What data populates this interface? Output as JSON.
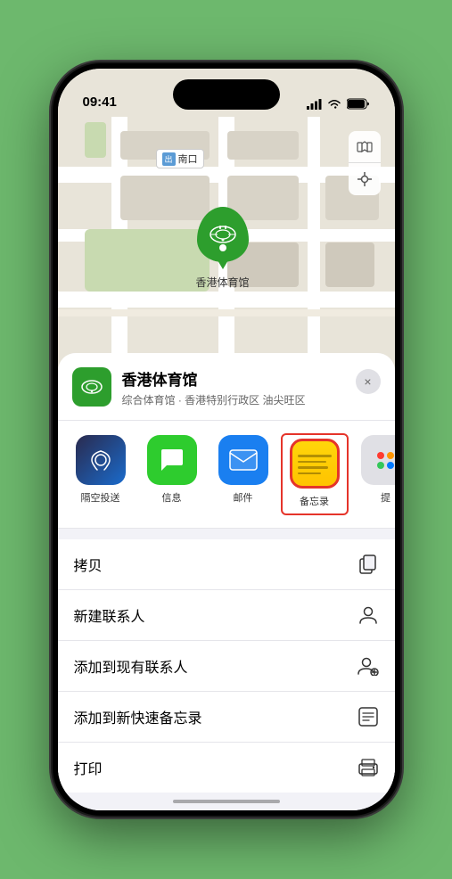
{
  "statusBar": {
    "time": "09:41",
    "locationArrow": "▶"
  },
  "map": {
    "locationLabel": "南口",
    "locationBadge": "出"
  },
  "venue": {
    "name": "香港体育馆",
    "description": "综合体育馆 · 香港特别行政区 油尖旺区",
    "pinLabel": "香港体育馆"
  },
  "shareRow": {
    "items": [
      {
        "id": "airdrop",
        "label": "隔空投送",
        "type": "airdrop"
      },
      {
        "id": "message",
        "label": "信息",
        "type": "message"
      },
      {
        "id": "mail",
        "label": "邮件",
        "type": "mail"
      },
      {
        "id": "notes",
        "label": "备忘录",
        "type": "notes"
      }
    ],
    "moreLabel": "提"
  },
  "actions": [
    {
      "id": "copy",
      "label": "拷贝",
      "icon": "copy"
    },
    {
      "id": "new-contact",
      "label": "新建联系人",
      "icon": "person"
    },
    {
      "id": "add-existing",
      "label": "添加到现有联系人",
      "icon": "person-add"
    },
    {
      "id": "quick-note",
      "label": "添加到新快速备忘录",
      "icon": "quick-note"
    },
    {
      "id": "print",
      "label": "打印",
      "icon": "print"
    }
  ],
  "closeButton": "×"
}
